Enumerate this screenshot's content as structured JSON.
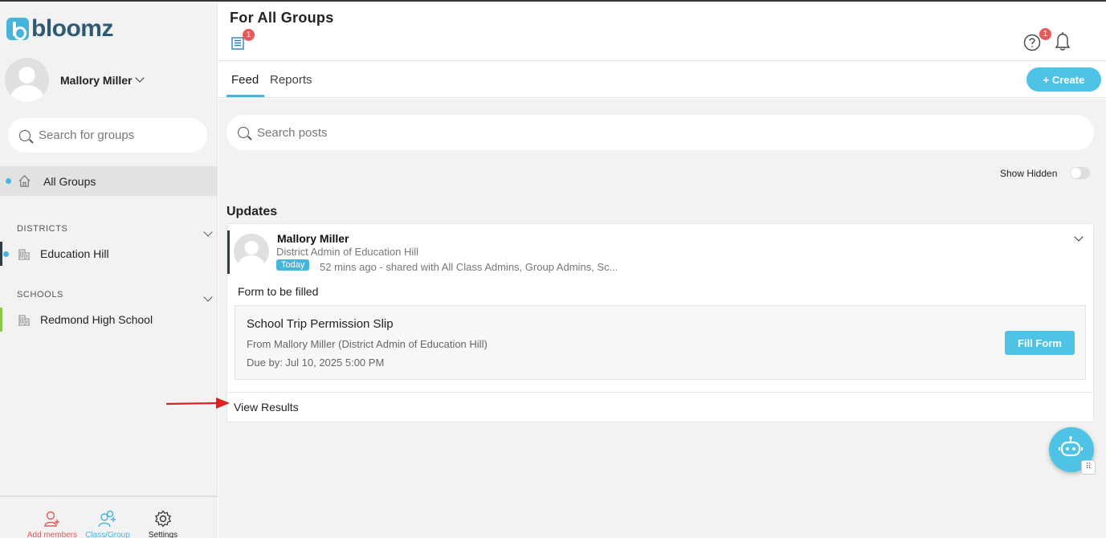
{
  "sidebar": {
    "logo_text": "bloomz",
    "profile_name": "Mallory Miller",
    "search_placeholder": "Search for groups",
    "all_groups_label": "All Groups",
    "districts_header": "DISTRICTS",
    "districts": [
      {
        "label": "Education Hill"
      }
    ],
    "schools_header": "SCHOOLS",
    "schools": [
      {
        "label": "Redmond High School"
      }
    ],
    "bottom": {
      "add_members": "Add members",
      "class_group": "Class/Group",
      "settings": "Settings"
    }
  },
  "header": {
    "title": "For All Groups",
    "doc_badge": "1",
    "help_badge": "1"
  },
  "tabs": {
    "feed": "Feed",
    "reports": "Reports",
    "create": "+ Create"
  },
  "feed": {
    "search_placeholder": "Search posts",
    "show_hidden_label": "Show Hidden",
    "show_hidden_on": false,
    "updates_heading": "Updates",
    "post": {
      "author": "Mallory Miller",
      "role": "District Admin of Education Hill",
      "today_badge": "Today",
      "meta": "52 mins ago - shared with All Class Admins, Group Admins, Sc...",
      "text": "Form to be filled",
      "form": {
        "title": "School Trip Permission Slip",
        "from": "From Mallory Miller (District Admin of Education Hill)",
        "due": "Due by: Jul 10, 2025 5:00 PM",
        "fill_button": "Fill Form"
      },
      "view_results": "View Results"
    }
  },
  "colors": {
    "accent": "#45b5dc",
    "button": "#4fc3e6",
    "badge": "#e45b5b",
    "add_members": "#e45b5b",
    "class_group": "#45b5dc",
    "arrow": "#e02020"
  },
  "icons": [
    "search-icon",
    "home-icon",
    "building-icon",
    "chevron-down-icon",
    "document-icon",
    "help-icon",
    "bell-icon",
    "add-member-icon",
    "class-group-icon",
    "gear-icon",
    "chatbot-icon"
  ]
}
